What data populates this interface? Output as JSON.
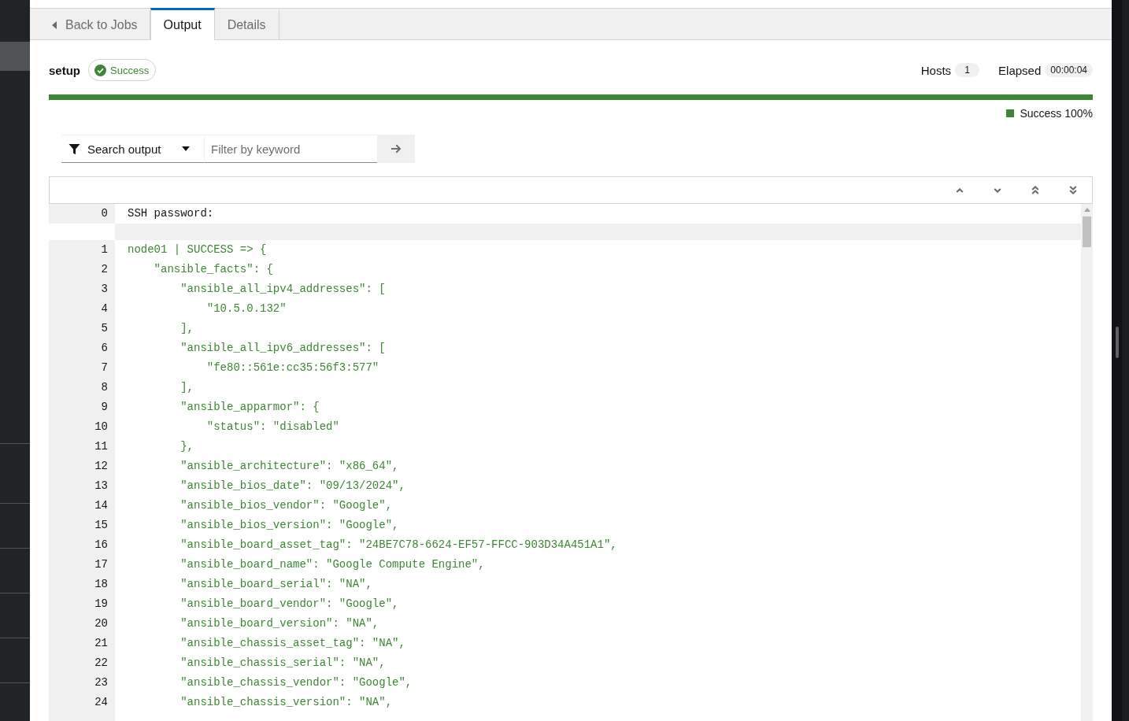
{
  "sidebar": {
    "items": [
      {
        "selected": false
      },
      {
        "selected": true
      }
    ]
  },
  "tabs": [
    {
      "kind": "back",
      "label": "Back to Jobs",
      "selected": false
    },
    {
      "kind": "tab",
      "label": "Output",
      "selected": true
    },
    {
      "kind": "tab",
      "label": "Details",
      "selected": false
    }
  ],
  "job": {
    "name": "setup",
    "status": {
      "kind": "success",
      "label": "Success"
    }
  },
  "stats": [
    {
      "label": "Hosts",
      "value": "1"
    },
    {
      "label": "Elapsed",
      "value": "00:00:04"
    }
  ],
  "progress": {
    "level": 1,
    "legend": [
      {
        "label": "Success 100%",
        "color": "#3e8635"
      }
    ]
  },
  "search": {
    "filter": "Search output",
    "placeholder": "Filter by keyword"
  },
  "output": {
    "lines": [
      {
        "kind": "prompt",
        "number": "0",
        "text": "SSH password:"
      },
      {
        "kind": "blank"
      },
      {
        "kind": "ok",
        "number": "1",
        "text": "node01 | SUCCESS => {"
      },
      {
        "kind": "ok",
        "number": "2",
        "text": "    \"ansible_facts\": {"
      },
      {
        "kind": "ok",
        "number": "3",
        "text": "        \"ansible_all_ipv4_addresses\": ["
      },
      {
        "kind": "ok",
        "number": "4",
        "text": "            \"10.5.0.132\""
      },
      {
        "kind": "ok",
        "number": "5",
        "text": "        ],"
      },
      {
        "kind": "ok",
        "number": "6",
        "text": "        \"ansible_all_ipv6_addresses\": ["
      },
      {
        "kind": "ok",
        "number": "7",
        "text": "            \"fe80::561e:cc35:56f3:577\""
      },
      {
        "kind": "ok",
        "number": "8",
        "text": "        ],"
      },
      {
        "kind": "ok",
        "number": "9",
        "text": "        \"ansible_apparmor\": {"
      },
      {
        "kind": "ok",
        "number": "10",
        "text": "            \"status\": \"disabled\""
      },
      {
        "kind": "ok",
        "number": "11",
        "text": "        },"
      },
      {
        "kind": "ok",
        "number": "12",
        "text": "        \"ansible_architecture\": \"x86_64\","
      },
      {
        "kind": "ok",
        "number": "13",
        "text": "        \"ansible_bios_date\": \"09/13/2024\","
      },
      {
        "kind": "ok",
        "number": "14",
        "text": "        \"ansible_bios_vendor\": \"Google\","
      },
      {
        "kind": "ok",
        "number": "15",
        "text": "        \"ansible_bios_version\": \"Google\","
      },
      {
        "kind": "ok",
        "number": "16",
        "text": "        \"ansible_board_asset_tag\": \"24BE7C78-6624-EF57-FFCC-903D34A451A1\","
      },
      {
        "kind": "ok",
        "number": "17",
        "text": "        \"ansible_board_name\": \"Google Compute Engine\","
      },
      {
        "kind": "ok",
        "number": "18",
        "text": "        \"ansible_board_serial\": \"NA\","
      },
      {
        "kind": "ok",
        "number": "19",
        "text": "        \"ansible_board_vendor\": \"Google\","
      },
      {
        "kind": "ok",
        "number": "20",
        "text": "        \"ansible_board_version\": \"NA\","
      },
      {
        "kind": "ok",
        "number": "21",
        "text": "        \"ansible_chassis_asset_tag\": \"NA\","
      },
      {
        "kind": "ok",
        "number": "22",
        "text": "        \"ansible_chassis_serial\": \"NA\","
      },
      {
        "kind": "ok",
        "number": "23",
        "text": "        \"ansible_chassis_vendor\": \"Google\","
      },
      {
        "kind": "ok",
        "number": "24",
        "text": "        \"ansible_chassis_version\": \"NA\","
      }
    ]
  }
}
